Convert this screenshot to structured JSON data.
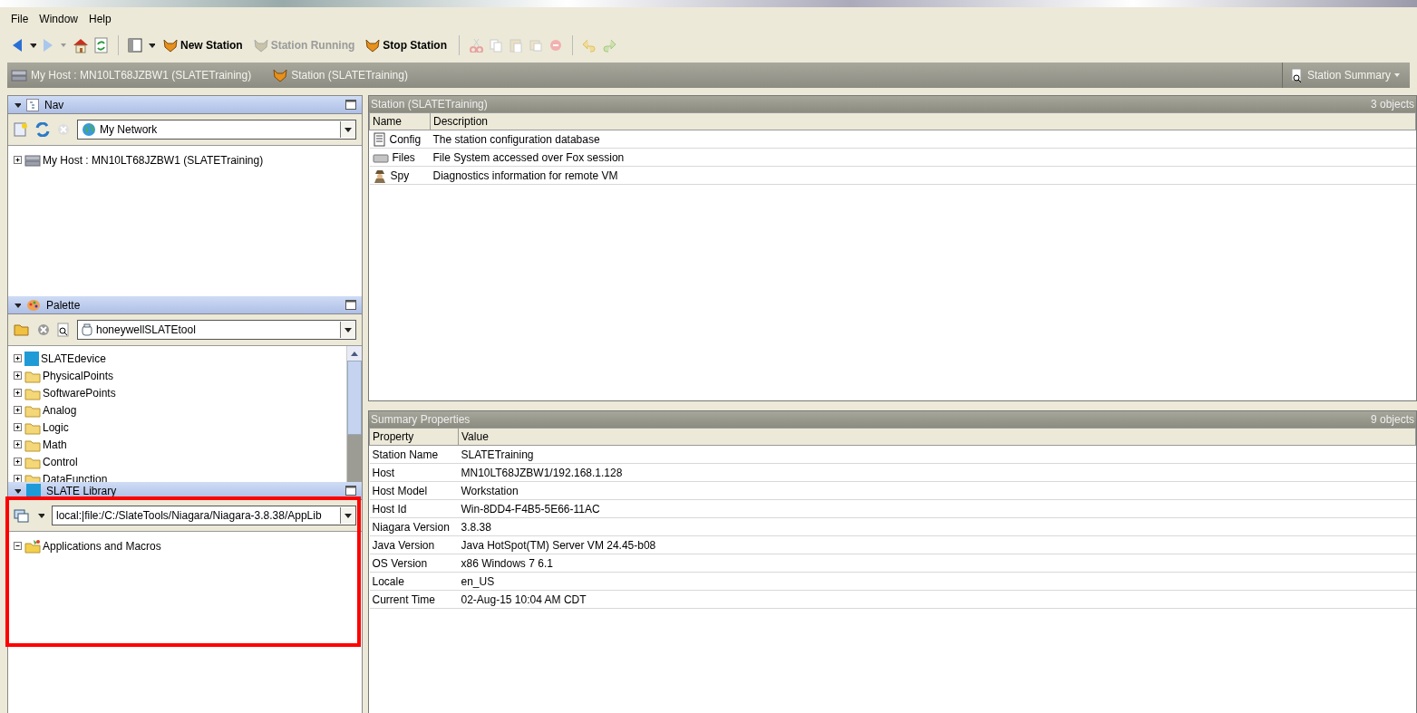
{
  "menu": [
    "File",
    "Window",
    "Help"
  ],
  "toolbar": {
    "buttons": [
      {
        "label": "New Station",
        "disabled": false
      },
      {
        "label": "Station Running",
        "disabled": true
      },
      {
        "label": "Stop Station",
        "disabled": false
      }
    ]
  },
  "breadcrumbs": [
    "My Host : MN10LT68JZBW1 (SLATETraining)",
    "Station (SLATETraining)"
  ],
  "view_selector": "Station Summary",
  "nav": {
    "title": "Nav",
    "dropdown": "My Network",
    "tree": [
      {
        "label": "My Host : MN10LT68JZBW1 (SLATETraining)",
        "kind": "host",
        "expanded": false
      }
    ]
  },
  "palette": {
    "title": "Palette",
    "dropdown": "honeywellSLATEtool",
    "tree": [
      {
        "label": "SLATEdevice",
        "kind": "slate",
        "expanded": false
      },
      {
        "label": "PhysicalPoints",
        "kind": "folder",
        "expanded": false
      },
      {
        "label": "SoftwarePoints",
        "kind": "folder",
        "expanded": false
      },
      {
        "label": "Analog",
        "kind": "folder",
        "expanded": false
      },
      {
        "label": "Logic",
        "kind": "folder",
        "expanded": false
      },
      {
        "label": "Math",
        "kind": "folder",
        "expanded": false
      },
      {
        "label": "Control",
        "kind": "folder",
        "expanded": false
      },
      {
        "label": "DataFunction",
        "kind": "folder",
        "expanded": false
      }
    ]
  },
  "library": {
    "title": "SLATE Library",
    "dropdown": "local:|file:/C:/SlateTools/Niagara/Niagara-3.8.38/AppLib",
    "tree": [
      {
        "label": "Applications and Macros",
        "kind": "app",
        "expanded": true
      }
    ]
  },
  "station_table": {
    "title": "Station (SLATETraining)",
    "count": "3 objects",
    "columns": [
      "Name",
      "Description"
    ],
    "rows": [
      {
        "kind": "config",
        "cells": [
          "Config",
          "The station configuration database"
        ]
      },
      {
        "kind": "files",
        "cells": [
          "Files",
          "File System accessed over Fox session"
        ]
      },
      {
        "kind": "spy",
        "cells": [
          "Spy",
          "Diagnostics information for remote VM"
        ]
      }
    ]
  },
  "summary_table": {
    "title": "Summary Properties",
    "count": "9 objects",
    "columns": [
      "Property",
      "Value"
    ],
    "rows": [
      {
        "cells": [
          "Station Name",
          "SLATETraining"
        ]
      },
      {
        "cells": [
          "Host",
          "MN10LT68JZBW1/192.168.1.128"
        ]
      },
      {
        "cells": [
          "Host Model",
          "Workstation"
        ]
      },
      {
        "cells": [
          "Host Id",
          "Win-8DD4-F4B5-5E66-11AC"
        ]
      },
      {
        "cells": [
          "Niagara Version",
          "3.8.38"
        ]
      },
      {
        "cells": [
          "Java Version",
          "Java HotSpot(TM) Server VM 24.45-b08"
        ]
      },
      {
        "cells": [
          "OS Version",
          "x86 Windows 7 6.1"
        ]
      },
      {
        "cells": [
          "Locale",
          "en_US"
        ]
      },
      {
        "cells": [
          "Current Time",
          "02-Aug-15 10:04 AM CDT"
        ]
      }
    ]
  }
}
